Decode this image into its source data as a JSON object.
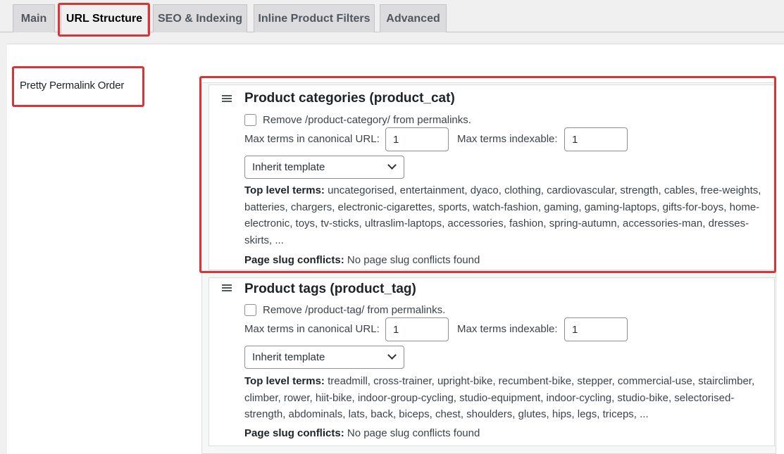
{
  "tabs": [
    {
      "label": "Main"
    },
    {
      "label": "URL Structure",
      "active": true
    },
    {
      "label": "SEO & Indexing"
    },
    {
      "label": "Inline Product Filters"
    },
    {
      "label": "Advanced"
    }
  ],
  "setting_label": "Pretty Permalink Order",
  "taxonomies": [
    {
      "title": "Product categories (product_cat)",
      "remove_label": "Remove /product-category/ from permalinks.",
      "max_canonical_label": "Max terms in canonical URL:",
      "max_canonical_value": "1",
      "max_indexable_label": "Max terms indexable:",
      "max_indexable_value": "1",
      "template": "Inherit template",
      "top_terms_label": "Top level terms:",
      "top_terms": "uncategorised, entertainment, dyaco, clothing, cardiovascular, strength, cables, free-weights, batteries, chargers, electronic-cigarettes, sports, watch-fashion, gaming, gaming-laptops, gifts-for-boys, home-electronic, toys, tv-sticks, ultraslim-laptops, accessories, fashion, spring-autumn, accessories-man, dresses-skirts, ...",
      "conflicts_label": "Page slug conflicts:",
      "conflicts": "No page slug conflicts found"
    },
    {
      "title": "Product tags (product_tag)",
      "remove_label": "Remove /product-tag/ from permalinks.",
      "max_canonical_label": "Max terms in canonical URL:",
      "max_canonical_value": "1",
      "max_indexable_label": "Max terms indexable:",
      "max_indexable_value": "1",
      "template": "Inherit template",
      "top_terms_label": "Top level terms:",
      "top_terms": "treadmill, cross-trainer, upright-bike, recumbent-bike, stepper, commercial-use, stairclimber, climber, rower, hiit-bike, indoor-group-cycling, studio-equipment, indoor-cycling, studio-bike, selectorised-strength, abdominals, lats, back, biceps, chest, shoulders, glutes, hips, legs, triceps, ...",
      "conflicts_label": "Page slug conflicts:",
      "conflicts": "No page slug conflicts found"
    }
  ],
  "colors": {
    "highlight": "#d63638",
    "tab_bg": "#dcdcde",
    "panel_bg": "#ffffff"
  },
  "icons": {
    "drag_handle": "drag-handle-icon",
    "dropdown": "chevron-down-icon"
  }
}
